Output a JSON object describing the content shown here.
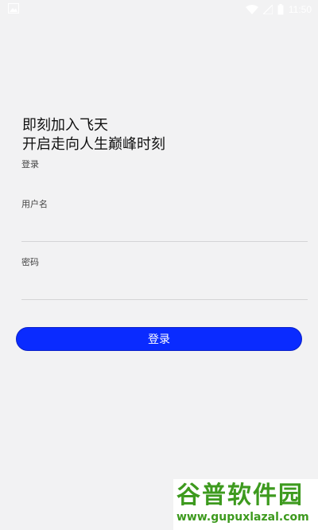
{
  "status_bar": {
    "time": "11:50",
    "icons": [
      "image-icon",
      "wifi-icon",
      "signal-icon",
      "battery-icon"
    ]
  },
  "headline": {
    "line1": "即刻加入飞天",
    "line2": "开启走向人生巅峰时刻"
  },
  "section_label": "登录",
  "form": {
    "username_label": "用户名",
    "username_value": "",
    "password_label": "密码",
    "password_value": "",
    "submit_label": "登录"
  },
  "watermark": {
    "logo_part1": "谷普",
    "logo_part2": "软件园",
    "url": "www.gupuxlazal.com"
  },
  "colors": {
    "background": "#f2f2f3",
    "button": "#0a2bff",
    "watermark_green": "#3d9a1e",
    "watermark_orange": "#e0622b"
  }
}
